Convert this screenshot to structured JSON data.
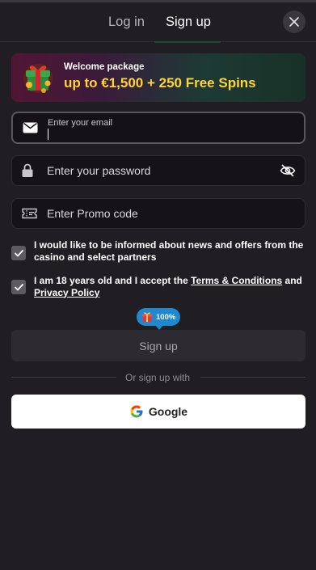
{
  "tabs": {
    "login": "Log in",
    "signup": "Sign up",
    "active": "signup"
  },
  "banner": {
    "subtitle": "Welcome package",
    "offer": "up to €1,500 + 250 Free Spins"
  },
  "form": {
    "email_label": "Enter your email",
    "email_value": "",
    "password_placeholder": "Enter your password",
    "promo_placeholder": "Enter Promo code"
  },
  "consents": {
    "news": {
      "text": "I would like to be informed about news and offers from the casino and select partners",
      "checked": true
    },
    "age": {
      "prefix": "I am 18 years old and I accept the ",
      "terms_link": "Terms & Conditions",
      "middle": " and ",
      "privacy_link": "Privacy Policy",
      "checked": true
    }
  },
  "progress": {
    "label": "100%",
    "value": 1.0
  },
  "buttons": {
    "signup": "Sign up",
    "divider": "Or sign up with",
    "google": "Google"
  },
  "icons": {
    "close": "close-icon",
    "gift": "gift-icon",
    "email": "envelope-icon",
    "password": "lock-icon",
    "visibility": "eye-off-icon",
    "promo": "ticket-icon",
    "check": "check-icon",
    "google": "google-icon"
  },
  "colors": {
    "background": "#201e23",
    "accent_yellow": "#ffd43b",
    "badge_blue": "#1e88d0",
    "google_button": "#ffffff"
  }
}
